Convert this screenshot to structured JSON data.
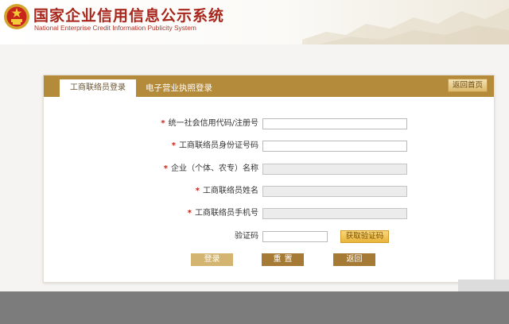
{
  "header": {
    "title": "国家企业信用信息公示系统",
    "subtitle": "National Enterprise Credit Information Publicity System",
    "emblem_icon": "national-emblem-icon"
  },
  "tabs": {
    "active": "工商联络员登录",
    "inactive": "电子营业执照登录",
    "home_button": "返回首页"
  },
  "form": {
    "required_mark": "*",
    "fields": [
      {
        "label": "统一社会信用代码/注册号",
        "value": "",
        "required": true,
        "disabled": false
      },
      {
        "label": "工商联络员身份证号码",
        "value": "",
        "required": true,
        "disabled": false
      },
      {
        "label": "企业（个体、农专）名称",
        "value": "",
        "required": true,
        "disabled": true
      },
      {
        "label": "工商联络员姓名",
        "value": "",
        "required": true,
        "disabled": true
      },
      {
        "label": "工商联络员手机号",
        "value": "",
        "required": true,
        "disabled": true
      }
    ],
    "captcha_label": "验证码",
    "captcha_value": "",
    "captcha_button": "获取验证码"
  },
  "actions": {
    "login": "登录",
    "reset": "重置",
    "back": "返回"
  },
  "colors": {
    "brand_red": "#a8261b",
    "tab_bar": "#b48a3b",
    "button_dark": "#a47a34",
    "button_light": "#d3b571",
    "captcha_button": "#e8b43c"
  }
}
